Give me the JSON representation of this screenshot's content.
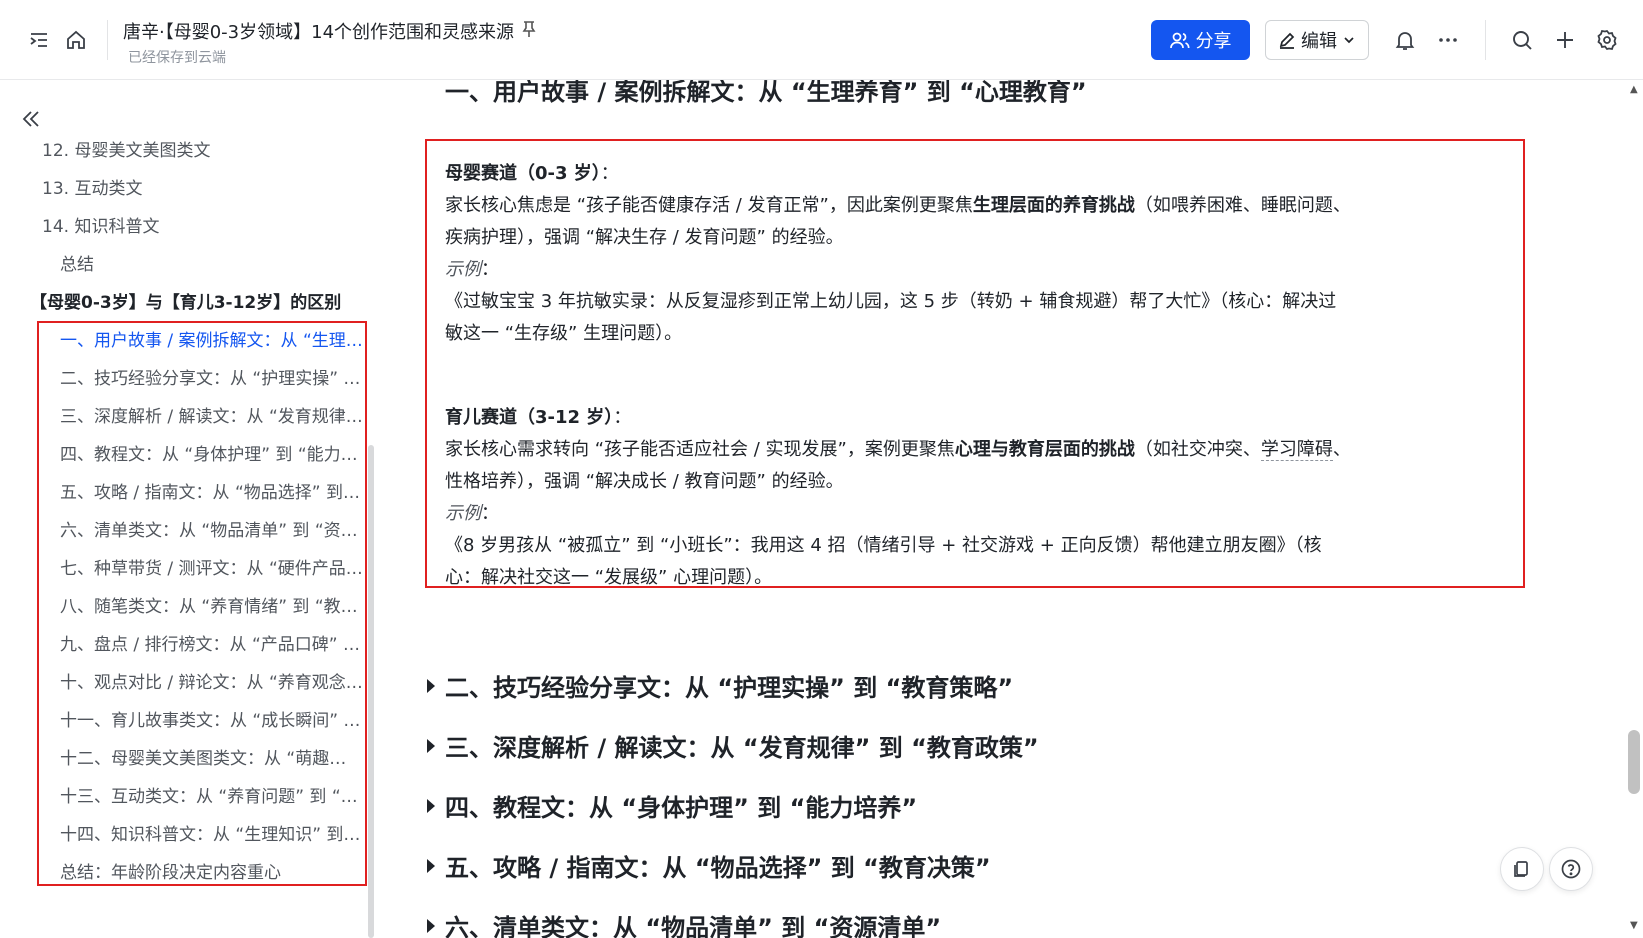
{
  "header": {
    "title": "唐辛·【母婴0-3岁领域】14个创作范围和灵感来源",
    "save_status": "已经保存到云端",
    "share_label": "分享",
    "edit_label": "编辑"
  },
  "toc": {
    "items": [
      {
        "label": "12. 母婴美文美图类文"
      },
      {
        "label": "13. 互动类文"
      },
      {
        "label": "14. 知识科普文"
      },
      {
        "label": "总结"
      },
      {
        "label": "【母婴0-3岁】与【育儿3-12岁】的区别"
      },
      {
        "label": "一、用户故事 / 案例拆解文：从 “生理养育” 到 “心理教育”"
      },
      {
        "label": "二、技巧经验分享文：从 “护理实操” 到 “教育策略”"
      },
      {
        "label": "三、深度解析 / 解读文：从 “发育规律” 到 “教育政策”"
      },
      {
        "label": "四、教程文：从 “身体护理” 到 “能力培养”"
      },
      {
        "label": "五、攻略 / 指南文：从 “物品选择” 到 “教育决策”"
      },
      {
        "label": "六、清单类文：从 “物品清单” 到 “资源清单”"
      },
      {
        "label": "七、种草带货 / 测评文：从 “硬件产品” 到 “软件产品”"
      },
      {
        "label": "八、随笔类文：从 “养育情绪” 到 “教育反思”"
      },
      {
        "label": "九、盘点 / 排行榜文：从 “产品口碑” 到 “教育资源”"
      },
      {
        "label": "十、观点对比 / 辩论文：从 “养育观念” 到 “教育观念”"
      },
      {
        "label": "十一、育儿故事类文：从 “成长瞬间” 到 “教育故事”"
      },
      {
        "label": "十二、母婴美文美图类文：从 “萌趣瞬间” 到 “成长记录”"
      },
      {
        "label": "十三、互动类文：从 “养育问题” 到 “教育问题”"
      },
      {
        "label": "十四、知识科普文：从 “生理知识” 到 “教育知识”"
      },
      {
        "label": "总结：年龄阶段决定内容重心"
      }
    ]
  },
  "content": {
    "section_heading": "一、用户故事 / 案例拆解文：从 “生理养育” 到 “心理教育”",
    "infant": {
      "label": "母婴赛道（0-3 岁）",
      "colon": "：",
      "l1_a": "家长核心焦虑是 “孩子能否健康存活 / 发育正常”，因此案例更聚焦",
      "l1_b": "生理层面的养育挑战",
      "l1_c": "（如喂养困难、睡眠问题、",
      "l2": "疾病护理），强调 “解决生存 / 发育问题” 的经验。",
      "example_label": "示例",
      "example_colon": "：",
      "ex1": "《过敏宝宝 3 年抗敏实录：从反复湿疹到正常上幼儿园，这 5 步（转奶 + 辅食规避）帮了大忙》（核心：解决过",
      "ex2": "敏这一 “生存级” 生理问题）。"
    },
    "child": {
      "label": "育儿赛道（3-12 岁）",
      "colon": "：",
      "l1_a": "家长核心需求转向 “孩子能否适应社会 / 实现发展”，案例更聚焦",
      "l1_b": "心理与教育层面的挑战",
      "l1_c": "（如社交冲突、",
      "l1_d": "学习障碍",
      "l1_e": "、",
      "l2": "性格培养），强调 “解决成长 / 教育问题” 的经验。",
      "example_label": "示例",
      "example_colon": "：",
      "ex1": "《8 岁男孩从 “被孤立” 到 “小班长”：我用这 4 招（情绪引导 + 社交游戏 + 正向反馈）帮他建立朋友圈》（核",
      "ex2": "心：解决社交这一 “发展级” 心理问题）。"
    },
    "collapsed_headings": [
      "二、技巧经验分享文：从 “护理实操” 到 “教育策略”",
      "三、深度解析 / 解读文：从 “发育规律” 到 “教育政策”",
      "四、教程文：从 “身体护理” 到 “能力培养”",
      "五、攻略 / 指南文：从 “物品选择” 到 “教育决策”",
      "六、清单类文：从 “物品清单” 到 “资源清单”"
    ]
  },
  "colors": {
    "accent": "#1456f0",
    "highlight_box": "#e02020"
  }
}
